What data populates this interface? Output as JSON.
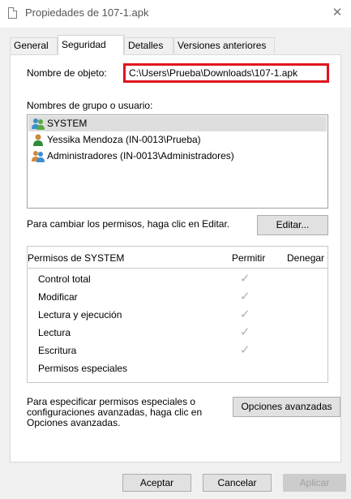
{
  "window": {
    "title": "Propiedades de 107-1.apk",
    "close_label": "✕"
  },
  "tabs": [
    {
      "label": "General"
    },
    {
      "label": "Seguridad",
      "active": true
    },
    {
      "label": "Detalles"
    },
    {
      "label": "Versiones anteriores"
    }
  ],
  "security": {
    "object_label": "Nombre de objeto:",
    "object_value": "C:\\Users\\Prueba\\Downloads\\107-1.apk",
    "group_label": "Nombres de grupo o usuario:",
    "users": [
      {
        "name": "SYSTEM",
        "icon": "group-users-icon",
        "selected": true
      },
      {
        "name": "Yessika Mendoza (IN-0013\\Prueba)",
        "icon": "user-icon"
      },
      {
        "name": "Administradores (IN-0013\\Administradores)",
        "icon": "group-users-icon"
      }
    ],
    "edit_hint": "Para cambiar los permisos, haga clic en Editar.",
    "edit_button": "Editar...",
    "permissions_header": {
      "title": "Permisos de SYSTEM",
      "allow": "Permitir",
      "deny": "Denegar"
    },
    "permissions": [
      {
        "name": "Control total",
        "allow": "✓",
        "deny": ""
      },
      {
        "name": "Modificar",
        "allow": "✓",
        "deny": ""
      },
      {
        "name": "Lectura y ejecución",
        "allow": "✓",
        "deny": ""
      },
      {
        "name": "Lectura",
        "allow": "✓",
        "deny": ""
      },
      {
        "name": "Escritura",
        "allow": "✓",
        "deny": ""
      },
      {
        "name": "Permisos especiales",
        "allow": "",
        "deny": ""
      }
    ],
    "advanced_hint": "Para especificar permisos especiales o configuraciones avanzadas, haga clic en Opciones avanzadas.",
    "advanced_button": "Opciones avanzadas"
  },
  "footer": {
    "ok": "Aceptar",
    "cancel": "Cancelar",
    "apply": "Aplicar"
  },
  "colors": {
    "highlight_border": "#e0141e",
    "selected_row": "#dedede",
    "check_color": "#b0b0b0"
  }
}
